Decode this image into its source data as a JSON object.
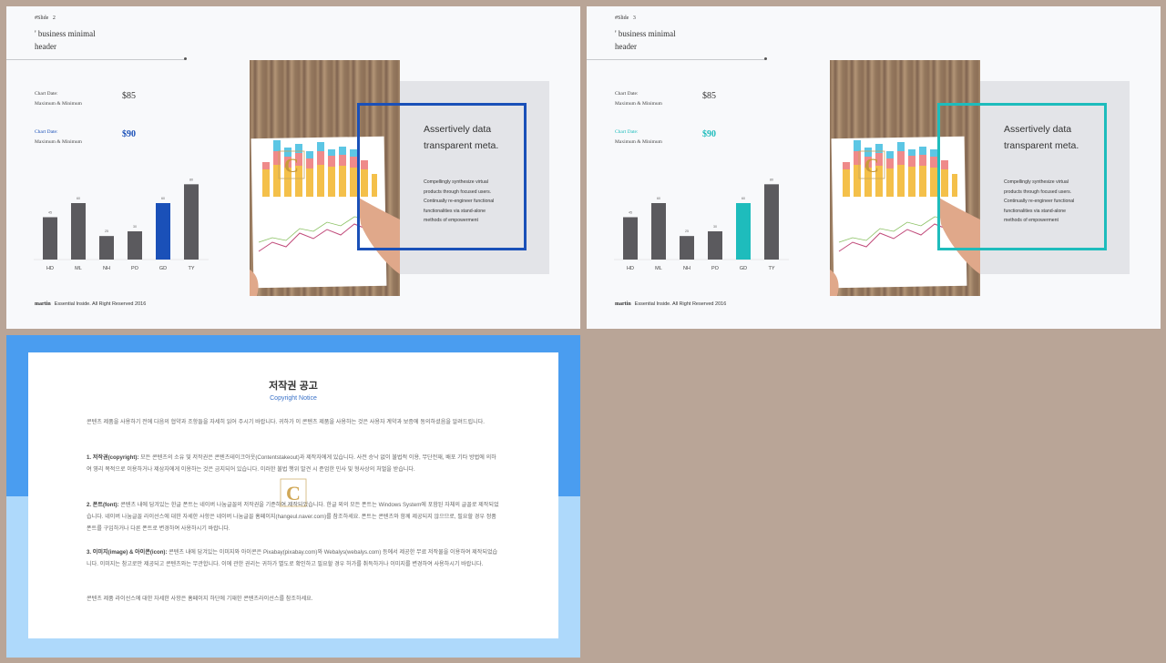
{
  "slides": [
    {
      "id": "slide1",
      "slide_label": "#Slide",
      "slide_num": "2",
      "header_line1": "' business minimal",
      "header_line2": "header",
      "stat1": {
        "label1": "Chart Date:",
        "label2": "Maximum & Minimum",
        "value": "$85"
      },
      "stat2": {
        "label1": "Chart Date:",
        "label2": "Maximum & Minimum",
        "value": "$90"
      },
      "accent": "#1a50b8",
      "panel_title_1": "Assertively data",
      "panel_title_2": "transparent meta.",
      "panel_body": [
        "Compellingly synthesize virtual",
        "products through focused users.",
        "Continually re-engineer functional",
        "functionalities via stand-alone",
        "methods of empowerment"
      ],
      "footer_brand": "martin",
      "footer_text": "Essential Inside. All Right Reserved 2016"
    },
    {
      "id": "slide2",
      "slide_label": "#Slide",
      "slide_num": "3",
      "header_line1": "' business minimal",
      "header_line2": "header",
      "stat1": {
        "label1": "Chart Date:",
        "label2": "Maximum & Minimum",
        "value": "$85"
      },
      "stat2": {
        "label1": "Chart Date:",
        "label2": "Maximum & Minimum",
        "value": "$90"
      },
      "accent": "#1ebcbc",
      "panel_title_1": "Assertively data",
      "panel_title_2": "transparent meta.",
      "panel_body": [
        "Compellingly synthesize virtual",
        "products through focused users.",
        "Continually re-engineer functional",
        "functionalities via stand-alone",
        "methods of empowerment"
      ],
      "footer_brand": "martin",
      "footer_text": "Essential Inside. All Right Reserved 2016"
    }
  ],
  "chart_data": [
    {
      "type": "bar",
      "categories": [
        "HD",
        "ML",
        "NH",
        "PO",
        "GD",
        "TY"
      ],
      "values": [
        45,
        60,
        25,
        30,
        60,
        80
      ],
      "value_labels": [
        "45",
        "60",
        "25",
        "30",
        "60",
        "80"
      ],
      "highlight_index": 4,
      "ylim": [
        0,
        90
      ],
      "bar_color": "#5b5a5e",
      "highlight_color": "#1a50b8"
    },
    {
      "type": "bar",
      "categories": [
        "HD",
        "ML",
        "NH",
        "PO",
        "GD",
        "TY"
      ],
      "values": [
        45,
        60,
        25,
        30,
        60,
        80
      ],
      "value_labels": [
        "45",
        "60",
        "25",
        "30",
        "60",
        "80"
      ],
      "highlight_index": 4,
      "ylim": [
        0,
        90
      ],
      "bar_color": "#5b5a5e",
      "highlight_color": "#1ebcbc"
    }
  ],
  "notice": {
    "title": "저작권 공고",
    "subtitle": "Copyright Notice",
    "intro": "콘텐츠 제품을 사용하기 전에 다음의 협약과 조항들을 자세히 읽어 주시기 바랍니다. 귀하가 이 콘텐츠 제품을 사용하는 것은 사용자 계약과 보증에 동의하셨음을 알려드립니다.",
    "s1_head": "1. 저작권(copyright):",
    "s1_body": " 모든 콘텐츠의 소유 및 저작권은 콘텐츠테이크아웃(Contentstakeout)과 제작자에게 있습니다. 사전 승낙 없이 불법적 이용, 무단전재, 배포 기타 방법에 의하여 영리 목적으로 이용하거나 제삼자에게 이용하는 것은 금지되어 있습니다. 이러한 불법 행위 발견 시 준엄한 민사 및 형사상의 처벌을 받습니다.",
    "s2_head": "2. 폰트(font):",
    "s2_body": " 콘텐츠 내에 담겨있는 한글 폰트는 네이버 나눔글꼴의 저작권을 기준하여 제작되었습니다. 한글 외의 모든 폰트는 Windows System에 포함된 자체의 글꼴로 제작되었습니다. 네이버 나눔글꼴 라이선스에 대한 자세한 사항은 네이버 나눔글꼴 홈페이지(hangeul.naver.com)를 참조하세요. 폰트는 콘텐츠와 함께 제공되지 않으므로, 필요할 경우 정품 폰트를 구입하거나 다른 폰트로 변경하여 사용하시기 바랍니다.",
    "s3_head": "3. 이미지(image) & 아이콘(icon):",
    "s3_body": " 콘텐츠 내에 담겨있는 이미지와 아이콘은 Pixabay(pixabay.com)와 Webalys(webalys.com) 등에서 제공한 무료 저작물을 이용하여 제작되었습니다. 이미지는 참고로만 제공되고 콘텐츠와는 무관합니다. 이에 관한 권리는 귀하가 별도로 확인하고 필요할 경우 허가를 취득하거나 이미지를 변경하여 사용하시기 바랍니다.",
    "closing": "콘텐츠 제품 라이선스에 대한 자세한 사항은 홈페이지 하단에 기재한 콘텐츠라이선스를 참조하세요."
  },
  "watermark_letter": "C",
  "colors": {
    "background": "#b9a597",
    "notice_top": "#4a9df0",
    "notice_bottom": "#aed9fb",
    "grey_bar": "#5b5a5e"
  }
}
